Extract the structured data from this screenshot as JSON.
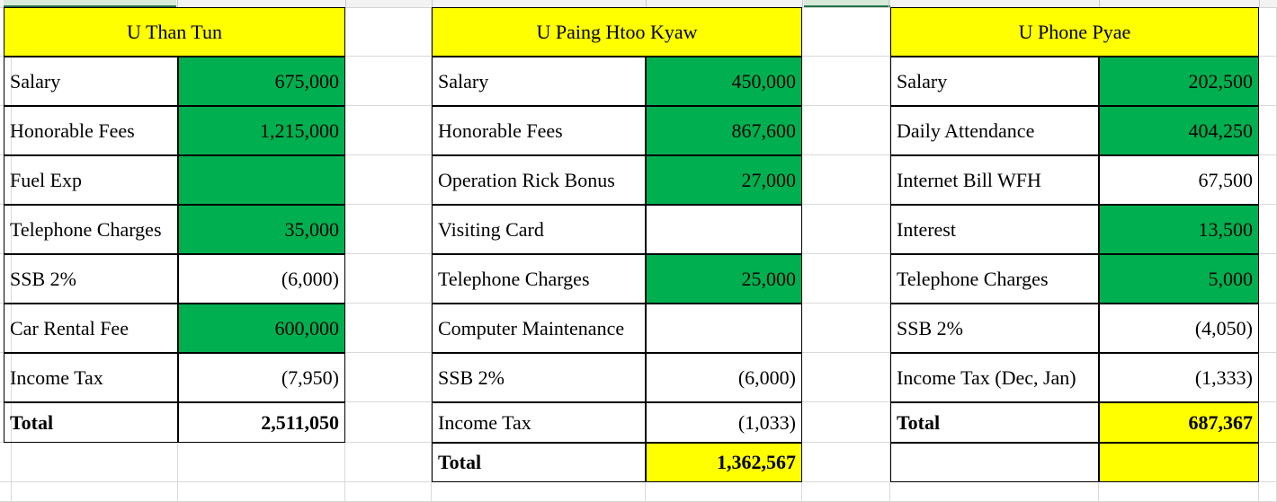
{
  "colors": {
    "header_fill": "#ffff00",
    "value_fill": "#00b050",
    "grid": "#d9d9d9"
  },
  "blocks": [
    {
      "name": "U Than Tun",
      "rows": [
        {
          "label": "Salary",
          "value": "675,000"
        },
        {
          "label": "Honorable Fees",
          "value": "1,215,000"
        },
        {
          "label": "Fuel Exp",
          "value": ""
        },
        {
          "label": "Telephone Charges",
          "value": "35,000"
        },
        {
          "label": "SSB 2%",
          "value": "(6,000)"
        },
        {
          "label": "Car Rental Fee",
          "value": "600,000"
        },
        {
          "label": "Income Tax",
          "value": "(7,950)"
        },
        {
          "label": "Total",
          "value": "2,511,050"
        }
      ]
    },
    {
      "name": "U Paing Htoo Kyaw",
      "rows": [
        {
          "label": "Salary",
          "value": "450,000"
        },
        {
          "label": "Honorable Fees",
          "value": "867,600"
        },
        {
          "label": "Operation Rick Bonus",
          "value": "27,000"
        },
        {
          "label": "Visiting Card",
          "value": ""
        },
        {
          "label": "Telephone Charges",
          "value": "25,000"
        },
        {
          "label": "Computer Maintenance",
          "value": ""
        },
        {
          "label": "SSB 2%",
          "value": "(6,000)"
        },
        {
          "label": "Income Tax",
          "value": "(1,033)"
        },
        {
          "label": "Total",
          "value": "1,362,567"
        }
      ]
    },
    {
      "name": "U Phone Pyae",
      "rows": [
        {
          "label": "Salary",
          "value": "202,500"
        },
        {
          "label": "Daily Attendance",
          "value": "404,250"
        },
        {
          "label": "Internet Bill WFH",
          "value": "67,500"
        },
        {
          "label": "Interest",
          "value": "13,500"
        },
        {
          "label": "Telephone Charges",
          "value": "5,000"
        },
        {
          "label": "SSB 2%",
          "value": "(4,050)"
        },
        {
          "label": "Income Tax (Dec, Jan)",
          "value": "(1,333)"
        },
        {
          "label": "Total",
          "value": "687,367"
        },
        {
          "label": "",
          "value": ""
        }
      ]
    }
  ]
}
